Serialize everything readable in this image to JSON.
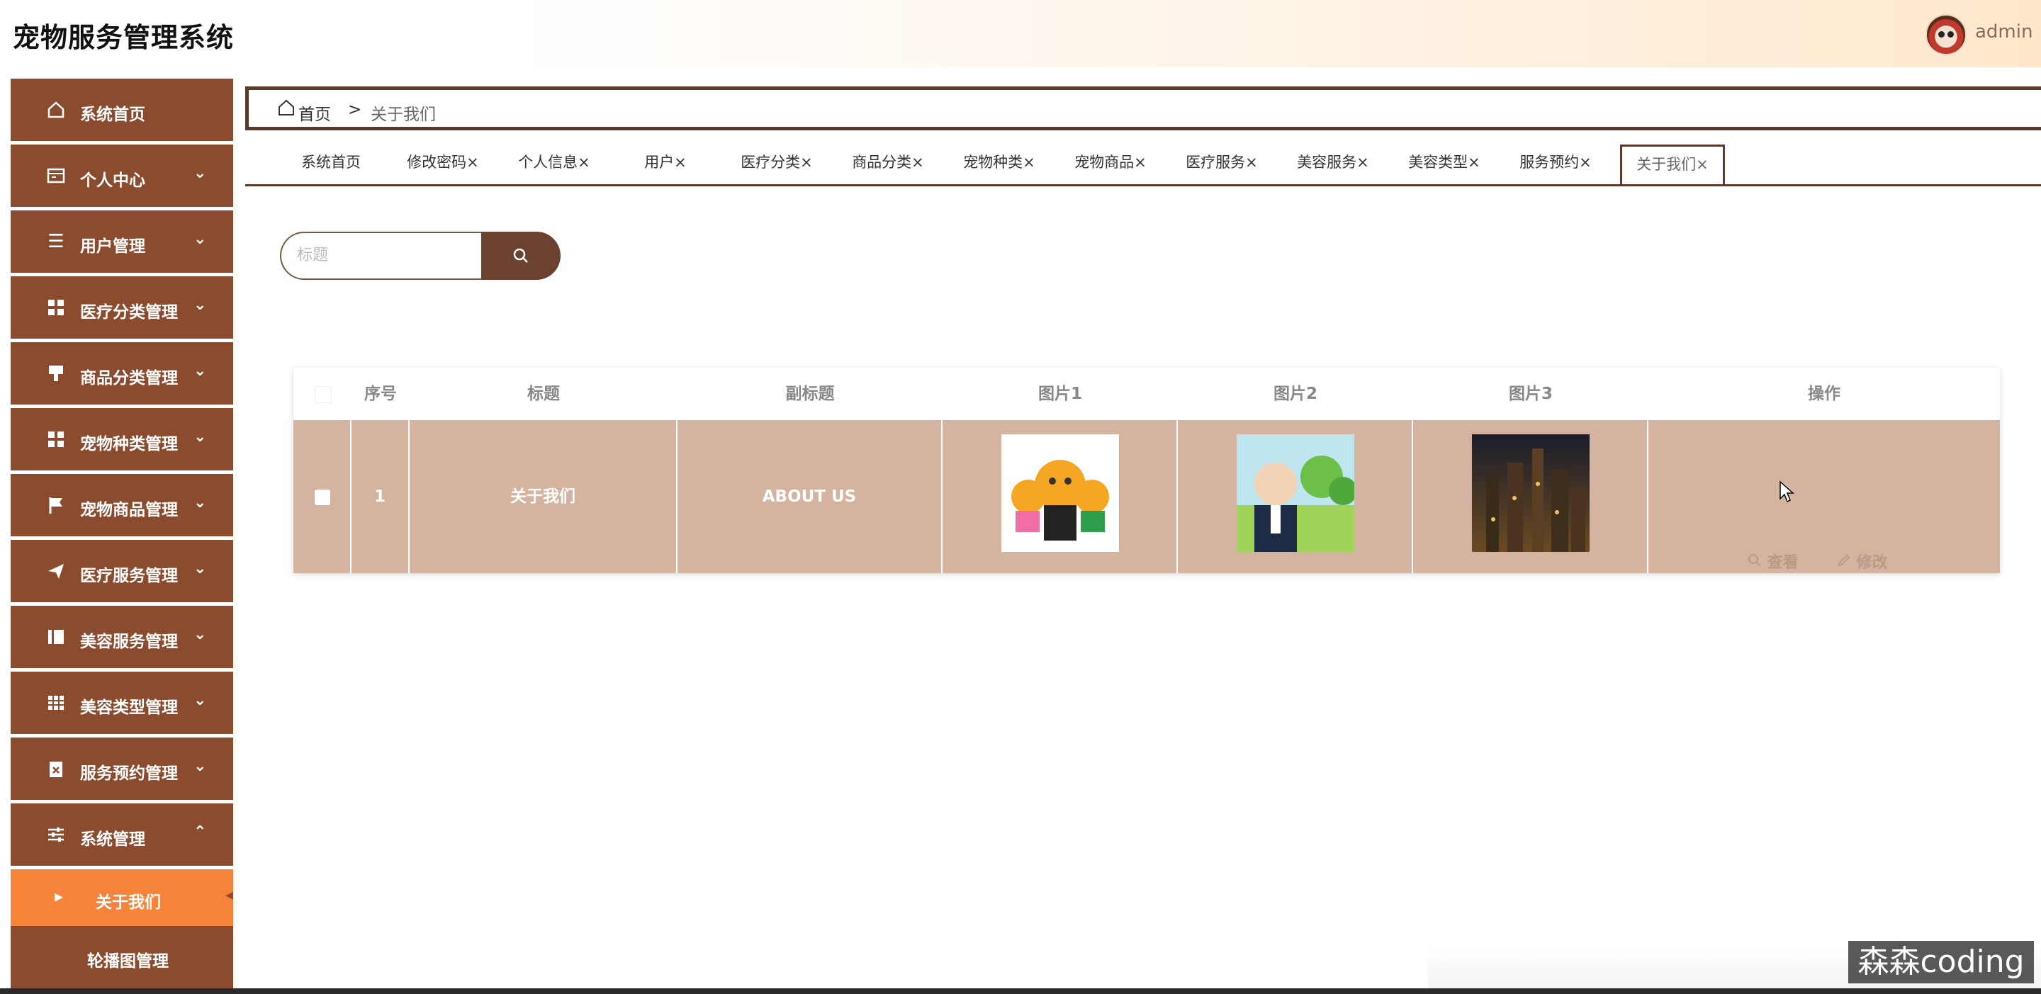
{
  "header": {
    "title": "宠物服务管理系统",
    "username": "admin"
  },
  "sidebar": {
    "items": [
      {
        "label": "系统首页",
        "icon": "home-icon",
        "has_chevron": false
      },
      {
        "label": "个人中心",
        "icon": "id-card-icon",
        "has_chevron": true
      },
      {
        "label": "用户管理",
        "icon": "list-icon",
        "has_chevron": true
      },
      {
        "label": "医疗分类管理",
        "icon": "grid-icon",
        "has_chevron": true
      },
      {
        "label": "商品分类管理",
        "icon": "brush-icon",
        "has_chevron": true
      },
      {
        "label": "宠物种类管理",
        "icon": "grid-icon",
        "has_chevron": true
      },
      {
        "label": "宠物商品管理",
        "icon": "flag-icon",
        "has_chevron": true
      },
      {
        "label": "医疗服务管理",
        "icon": "send-icon",
        "has_chevron": true
      },
      {
        "label": "美容服务管理",
        "icon": "book-icon",
        "has_chevron": true
      },
      {
        "label": "美容类型管理",
        "icon": "table-icon",
        "has_chevron": true
      },
      {
        "label": "服务预约管理",
        "icon": "clipboard-icon",
        "has_chevron": true
      },
      {
        "label": "系统管理",
        "icon": "sliders-icon",
        "has_chevron": true
      }
    ],
    "sub_items": [
      {
        "label": "关于我们",
        "active": true
      },
      {
        "label": "轮播图管理",
        "active": false
      }
    ]
  },
  "breadcrumb": {
    "home": "首页",
    "separator": ">",
    "current": "关于我们"
  },
  "tabs": [
    {
      "label": "系统首页"
    },
    {
      "label": "修改密码×"
    },
    {
      "label": "个人信息×"
    },
    {
      "label": "用户×"
    },
    {
      "label": "医疗分类×"
    },
    {
      "label": "商品分类×"
    },
    {
      "label": "宠物种类×"
    },
    {
      "label": "宠物商品×"
    },
    {
      "label": "医疗服务×"
    },
    {
      "label": "美容服务×"
    },
    {
      "label": "美容类型×"
    },
    {
      "label": "服务预约×"
    },
    {
      "label": "关于我们×"
    }
  ],
  "search": {
    "placeholder": "标题"
  },
  "table": {
    "headers": [
      "序号",
      "标题",
      "副标题",
      "图片1",
      "图片2",
      "图片3",
      "操作"
    ],
    "rows": [
      {
        "index": "1",
        "title": "关于我们",
        "subtitle": "ABOUT US",
        "view_label": "查看",
        "edit_label": "修改"
      }
    ]
  },
  "watermark": "森森coding",
  "colors": {
    "sidebar": "#8b4b2e",
    "active": "#f5843a",
    "row": "#d4b4a0",
    "accent": "#6b4230"
  }
}
